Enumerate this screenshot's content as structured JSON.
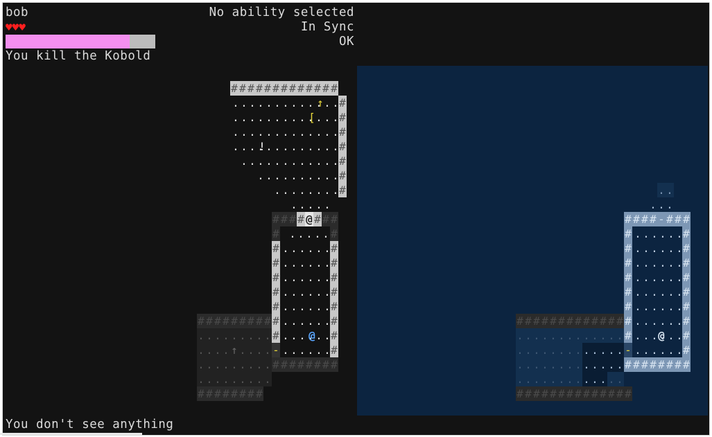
{
  "hud": {
    "player_name": "bob",
    "hearts": "♥♥♥",
    "energy_fraction": 0.83,
    "combat_message": "You kill the Kobold",
    "ability_status": "No ability selected",
    "sync_status": "In Sync",
    "connection_status": "OK",
    "look_message": "You don't see anything"
  },
  "colors": {
    "background": "#131313",
    "panel": "#0c2440",
    "wall_lit": "#c8c8c8",
    "wall_dim": "#2b2b2b",
    "wall_panel": "#7d97b5",
    "floor": "#e6e6e6",
    "floor_dim": "#555555",
    "item": "#e4d43a",
    "player": "#5aa6ff",
    "heart": "#ff1f1f",
    "energy": "#f48fef"
  },
  "glyphs": {
    "wall": "#",
    "floor": ".",
    "stairs_up": "↑",
    "armor": "[",
    "potion": "!",
    "player": "@",
    "door": "-"
  }
}
